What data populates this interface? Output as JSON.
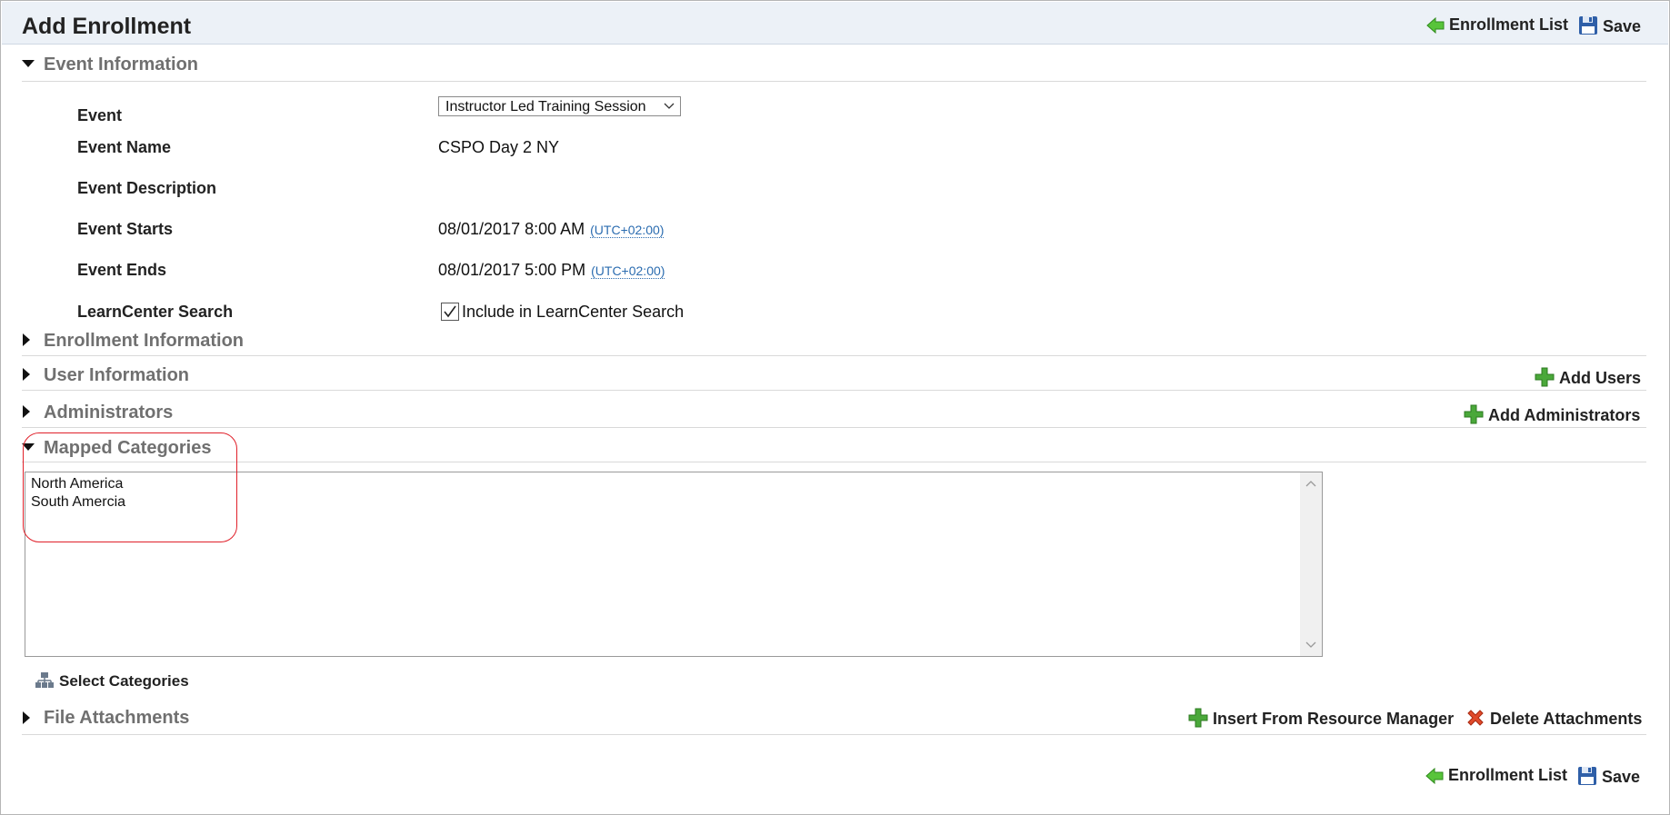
{
  "header": {
    "title": "Add Enrollment",
    "enrollment_list": "Enrollment List",
    "save": "Save"
  },
  "sections": {
    "event_information": "Event Information",
    "enrollment_information": "Enrollment Information",
    "user_information": "User Information",
    "administrators": "Administrators",
    "mapped_categories": "Mapped Categories",
    "file_attachments": "File Attachments"
  },
  "event": {
    "labels": {
      "event": "Event",
      "event_name": "Event Name",
      "event_description": "Event Description",
      "event_starts": "Event Starts",
      "event_ends": "Event Ends",
      "learncenter_search": "LearnCenter Search"
    },
    "event_select_value": "Instructor Led Training Session",
    "event_name": "CSPO Day 2 NY",
    "event_description": "",
    "starts": "08/01/2017 8:00 AM",
    "starts_tz": "(UTC+02:00)",
    "ends": "08/01/2017 5:00 PM",
    "ends_tz": "(UTC+02:00)",
    "learncenter_checkbox_label": "Include in LearnCenter Search",
    "learncenter_checked": true
  },
  "actions": {
    "add_users": "Add Users",
    "add_administrators": "Add Administrators",
    "select_categories": "Select Categories",
    "insert_from_resource_manager": "Insert From Resource Manager",
    "delete_attachments": "Delete Attachments"
  },
  "mapped_categories": {
    "items": [
      "North America",
      "South Amercia"
    ]
  },
  "footer": {
    "enrollment_list": "Enrollment List",
    "save": "Save"
  },
  "colors": {
    "header_bg": "#ecf1f7",
    "section_title": "#707070",
    "link": "#2b6cb0",
    "highlight": "#e0202a",
    "add_icon": "#3f9b2c",
    "delete_icon": "#d9391c"
  },
  "icons": {
    "back": "green-left-arrow-icon",
    "save": "floppy-disk-icon",
    "add": "green-plus-icon",
    "delete": "red-x-icon",
    "select_categories": "category-tree-icon"
  }
}
